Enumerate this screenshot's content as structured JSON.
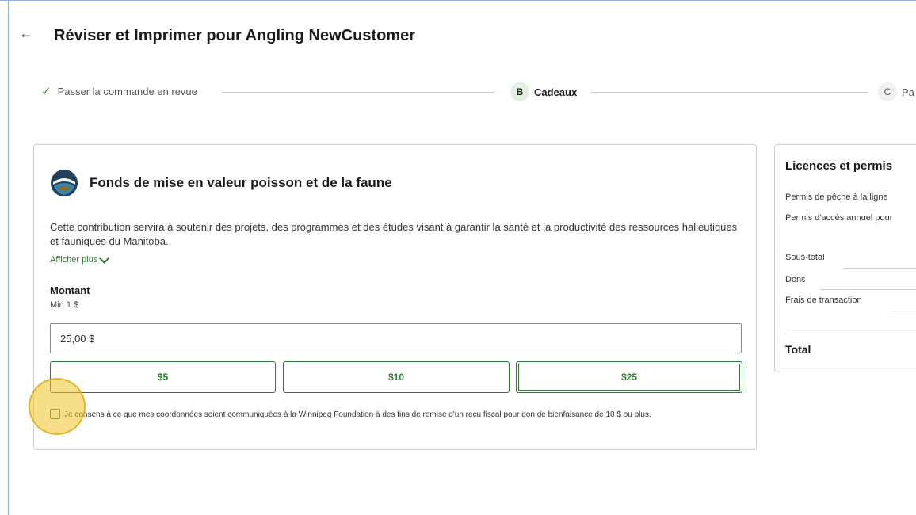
{
  "header": {
    "back_icon": "←",
    "title": "Réviser et Imprimer pour Angling NewCustomer"
  },
  "stepper": {
    "steps": [
      {
        "label": "Passer la commande en revue",
        "status": "completed",
        "marker": "✓"
      },
      {
        "label": "Cadeaux",
        "status": "current",
        "marker": "B"
      },
      {
        "label": "Pa",
        "status": "upcoming",
        "marker": "C"
      }
    ]
  },
  "donation": {
    "title": "Fonds de mise en valeur poisson et de la faune",
    "description": "Cette contribution servira à soutenir des projets, des programmes et des études visant à garantir la santé et la productivité des ressources halieutiques et fauniques du Manitoba.",
    "show_more": "Afficher plus",
    "amount_label": "Montant",
    "min_label": "Min 1 $",
    "amount_value": "25,00 $",
    "buttons": [
      "$5",
      "$10",
      "$25"
    ],
    "selected_button": "$25",
    "consent_text": "Je consens à ce que mes coordonnées soient communiquées à la Winnipeg Foundation à des fins de remise d'un reçu fiscal pour don de bienfaisance de 10 $ ou plus.",
    "consent_checked": false
  },
  "summary": {
    "title": "Licences et permis",
    "items": [
      "Permis de pêche à la ligne",
      "Permis d'accès annuel pour"
    ],
    "subtotal_label": "Sous-total",
    "donations_label": "Dons",
    "fees_label": "Frais de transaction",
    "total_label": "Total"
  },
  "colors": {
    "accent_green": "#2e7d32",
    "highlight": "#f0c428"
  }
}
